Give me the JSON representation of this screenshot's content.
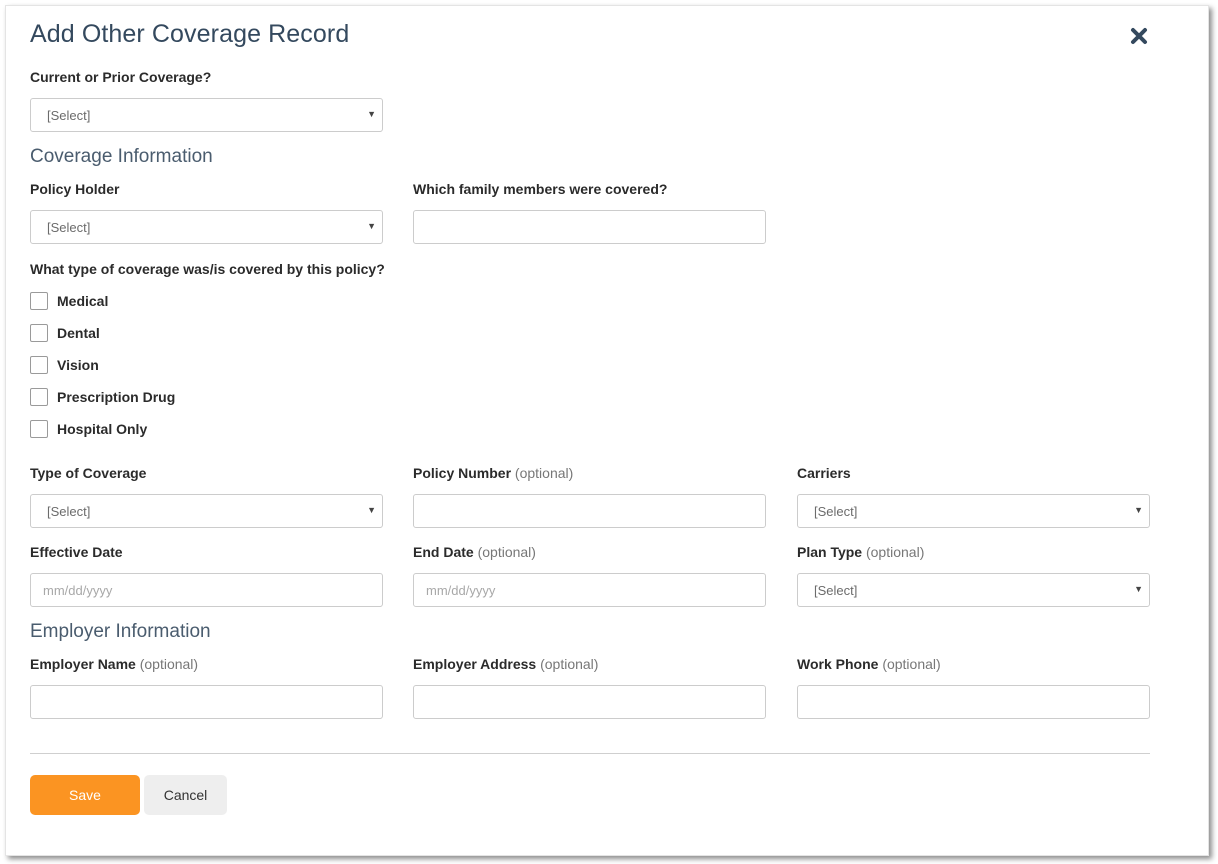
{
  "modal": {
    "title": "Add Other Coverage Record",
    "close_icon": "close-x-icon"
  },
  "current_prior": {
    "label": "Current or Prior Coverage?",
    "value": "[Select]"
  },
  "coverage_info": {
    "section_title": "Coverage Information",
    "policy_holder": {
      "label": "Policy Holder",
      "value": "[Select]"
    },
    "family_members": {
      "label": "Which family members were covered?",
      "value": ""
    },
    "coverage_types_question": "What type of coverage was/is covered by this policy?",
    "coverage_types": [
      {
        "label": "Medical",
        "checked": false
      },
      {
        "label": "Dental",
        "checked": false
      },
      {
        "label": "Vision",
        "checked": false
      },
      {
        "label": "Prescription Drug",
        "checked": false
      },
      {
        "label": "Hospital Only",
        "checked": false
      }
    ],
    "type_of_coverage": {
      "label": "Type of Coverage",
      "value": "[Select]"
    },
    "policy_number": {
      "label": "Policy Number",
      "optional": "(optional)",
      "value": ""
    },
    "carriers": {
      "label": "Carriers",
      "value": "[Select]"
    },
    "effective_date": {
      "label": "Effective Date",
      "placeholder": "mm/dd/yyyy"
    },
    "end_date": {
      "label": "End Date",
      "optional": "(optional)",
      "placeholder": "mm/dd/yyyy"
    },
    "plan_type": {
      "label": "Plan Type",
      "optional": "(optional)",
      "value": "[Select]"
    }
  },
  "employer_info": {
    "section_title": "Employer Information",
    "employer_name": {
      "label": "Employer Name",
      "optional": "(optional)",
      "value": ""
    },
    "employer_address": {
      "label": "Employer Address",
      "optional": "(optional)",
      "value": ""
    },
    "work_phone": {
      "label": "Work Phone",
      "optional": "(optional)",
      "value": ""
    }
  },
  "actions": {
    "save_label": "Save",
    "cancel_label": "Cancel"
  },
  "colors": {
    "title": "#34495e",
    "save_button": "#fb9422",
    "cancel_button": "#eeeeee"
  }
}
